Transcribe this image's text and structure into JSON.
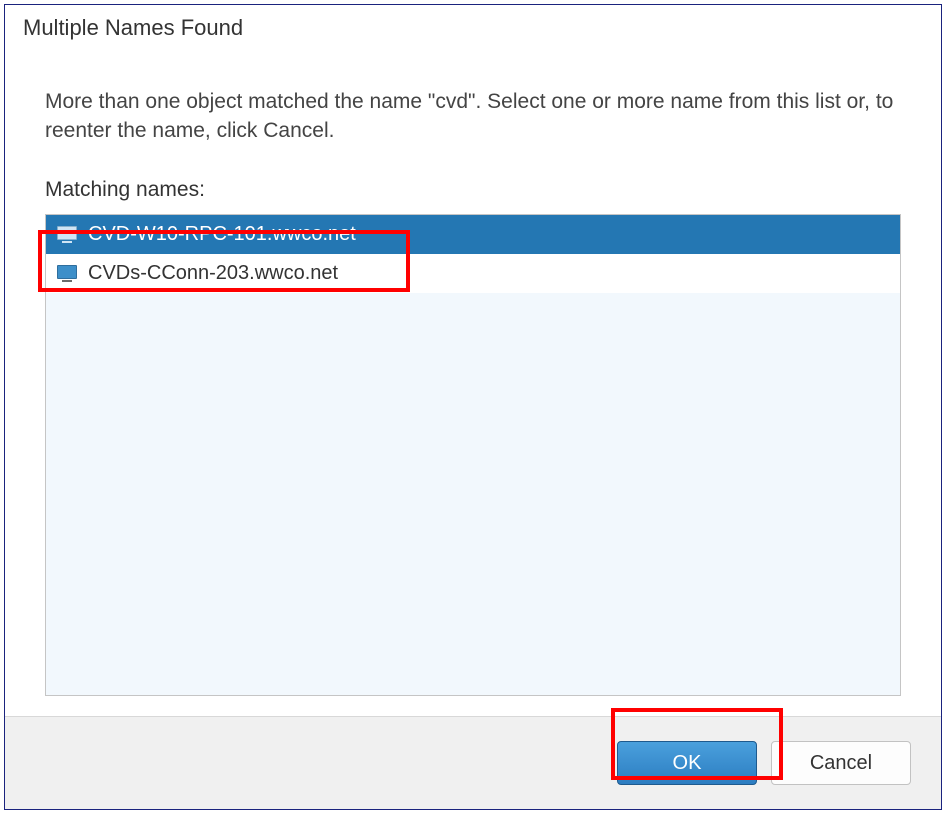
{
  "dialog": {
    "title": "Multiple Names Found",
    "description": "More than one object matched the name \"cvd\". Select one or more name from this list or, to reenter the name, click Cancel.",
    "list_label": "Matching names:"
  },
  "items": [
    {
      "name": "CVD-W10-RPC-101.wwco.net",
      "selected": true
    },
    {
      "name": "CVDs-CConn-203.wwco.net",
      "selected": false
    }
  ],
  "buttons": {
    "ok": "OK",
    "cancel": "Cancel"
  }
}
